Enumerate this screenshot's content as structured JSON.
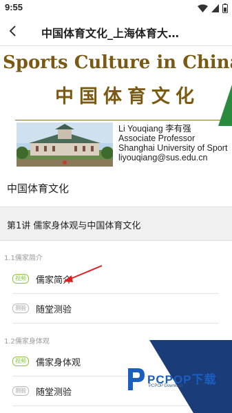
{
  "status_bar": {
    "time": "9:55"
  },
  "header": {
    "title": "中国体育文化_上海体育大…"
  },
  "banner": {
    "title_en": "Sports Culture in China",
    "title_cn": "中国体育文化",
    "instructor_name": "Li Youqiang 李有强",
    "instructor_title": "Associate Professor",
    "institution": "Shanghai University of Sport",
    "email": "liyouqiang@sus.edu.cn"
  },
  "course": {
    "title": "中国体育文化"
  },
  "chapter": {
    "title": "第1讲 儒家身体观与中国体育文化"
  },
  "sections": [
    {
      "label": "1.1儒家简介",
      "lessons": [
        {
          "tag": "视频",
          "label": "儒家简介"
        },
        {
          "tag": "测验",
          "label": "随堂测验"
        }
      ]
    },
    {
      "label": "1.2儒家身体观",
      "lessons": [
        {
          "tag": "视频",
          "label": "儒家身体观"
        },
        {
          "tag": "测验",
          "label": "随堂测验"
        }
      ]
    }
  ],
  "watermark": {
    "brand": "PCPOP下载",
    "sub": "PCPOP Download"
  },
  "colors": {
    "video_tag": "#8cc63e",
    "banner_text": "#7a5a12",
    "watermark_blue": "#1a3d7a"
  }
}
